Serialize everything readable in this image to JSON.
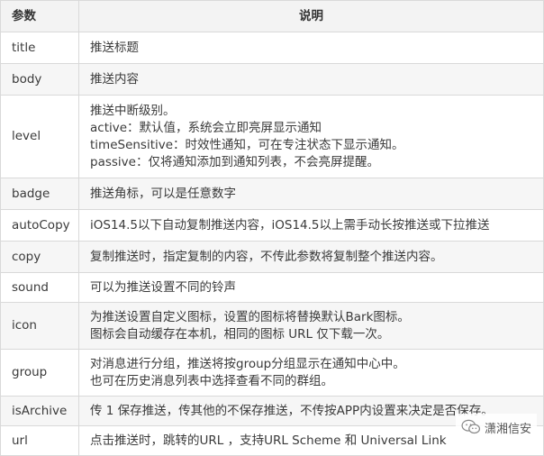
{
  "table": {
    "header": {
      "param": "参数",
      "desc": "说明"
    },
    "rows": [
      {
        "name": "title",
        "lines": [
          "推送标题"
        ]
      },
      {
        "name": "body",
        "lines": [
          "推送内容"
        ]
      },
      {
        "name": "level",
        "lines": [
          "推送中断级别。",
          "active：默认值，系统会立即亮屏显示通知",
          "timeSensitive：时效性通知，可在专注状态下显示通知。",
          "passive：仅将通知添加到通知列表，不会亮屏提醒。"
        ]
      },
      {
        "name": "badge",
        "lines": [
          "推送角标，可以是任意数字"
        ]
      },
      {
        "name": "autoCopy",
        "lines": [
          "iOS14.5以下自动复制推送内容，iOS14.5以上需手动长按推送或下拉推送"
        ]
      },
      {
        "name": "copy",
        "lines": [
          "复制推送时，指定复制的内容，不传此参数将复制整个推送内容。"
        ]
      },
      {
        "name": "sound",
        "lines": [
          "可以为推送设置不同的铃声"
        ]
      },
      {
        "name": "icon",
        "lines": [
          "为推送设置自定义图标，设置的图标将替换默认Bark图标。",
          "图标会自动缓存在本机，相同的图标 URL 仅下载一次。"
        ]
      },
      {
        "name": "group",
        "lines": [
          "对消息进行分组，推送将按group分组显示在通知中心中。",
          "也可在历史消息列表中选择查看不同的群组。"
        ]
      },
      {
        "name": "isArchive",
        "lines": [
          "传 1 保存推送，传其他的不保存推送，不传按APP内设置来决定是否保存。"
        ]
      },
      {
        "name": "url",
        "lines": [
          "点击推送时，跳转的URL ，支持URL Scheme 和 Universal Link"
        ]
      }
    ]
  },
  "watermark": {
    "text": "潇湘信安",
    "icon": "wechat-icon"
  }
}
